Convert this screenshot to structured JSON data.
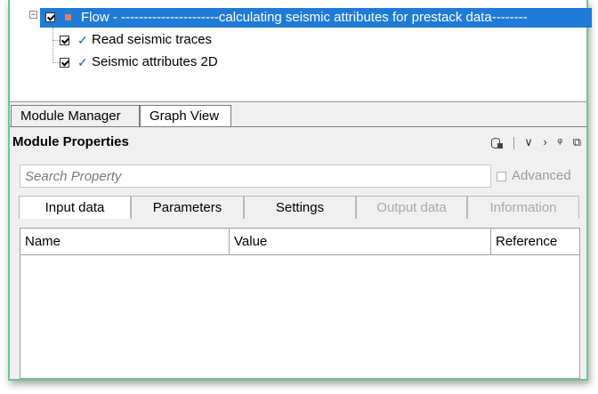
{
  "tree": {
    "flow": {
      "label": "Flow - ----------------------calculating seismic attributes for prestack data--------",
      "checked": true
    },
    "children": [
      {
        "label": "Read seismic traces",
        "checked": true
      },
      {
        "label": "Seismic attributes 2D",
        "checked": true
      }
    ]
  },
  "view_tabs": [
    {
      "label": "Module Manager",
      "active": false
    },
    {
      "label": "Graph View",
      "active": true
    }
  ],
  "module_properties": {
    "title": "Module Properties",
    "icons": [
      "database-lock-icon",
      "chevron-down-icon",
      "chevron-right-icon",
      "pin-icon",
      "restore-window-icon"
    ],
    "search": {
      "placeholder": "Search Property",
      "value": ""
    },
    "advanced": {
      "label": "Advanced",
      "checked": false,
      "enabled": false
    },
    "tabs": [
      {
        "label": "Input data",
        "active": true,
        "enabled": true
      },
      {
        "label": "Parameters",
        "active": false,
        "enabled": true
      },
      {
        "label": "Settings",
        "active": false,
        "enabled": true
      },
      {
        "label": "Output data",
        "active": false,
        "enabled": false
      },
      {
        "label": "Information",
        "active": false,
        "enabled": false
      }
    ],
    "grid": {
      "columns": [
        "Name",
        "Value",
        "Reference"
      ],
      "rows": []
    }
  },
  "colors": {
    "selection": "#1e7bd6",
    "frame_border": "#69c98c",
    "check_blue": "#1e5fb3",
    "flow_square": "#e17b6b"
  }
}
